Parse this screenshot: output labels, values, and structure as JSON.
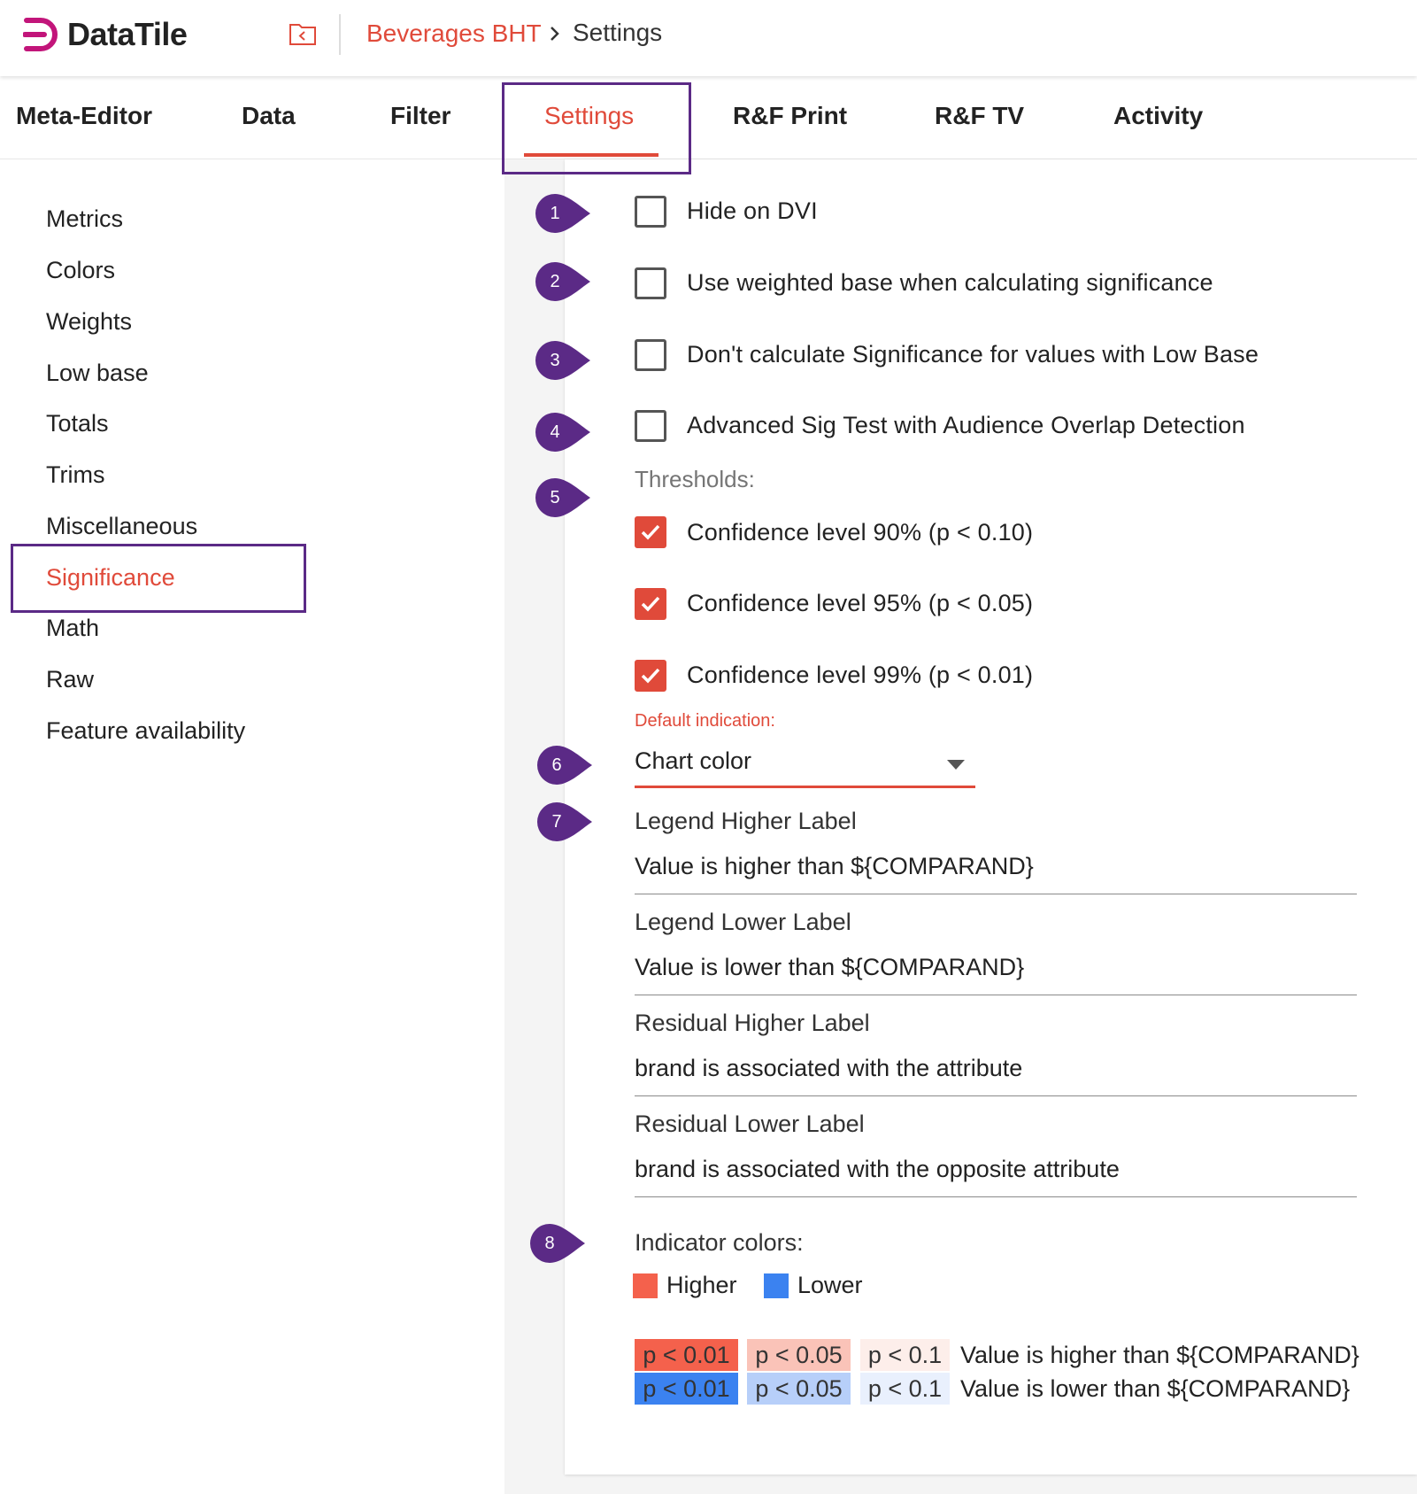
{
  "app": {
    "name": "DataTile",
    "brand_color": "#c2157a"
  },
  "breadcrumb": {
    "project": "Beverages BHT",
    "current": "Settings"
  },
  "tabs": [
    {
      "label": "Meta-Editor"
    },
    {
      "label": "Data"
    },
    {
      "label": "Filter"
    },
    {
      "label": "Settings",
      "active": true
    },
    {
      "label": "R&F Print"
    },
    {
      "label": "R&F TV"
    },
    {
      "label": "Activity"
    }
  ],
  "sidebar": {
    "items": [
      {
        "label": "Metrics"
      },
      {
        "label": "Colors"
      },
      {
        "label": "Weights"
      },
      {
        "label": "Low base"
      },
      {
        "label": "Totals"
      },
      {
        "label": "Trims"
      },
      {
        "label": "Miscellaneous"
      },
      {
        "label": "Significance",
        "active": true
      },
      {
        "label": "Math"
      },
      {
        "label": "Raw"
      },
      {
        "label": "Feature availability"
      }
    ]
  },
  "markers": [
    "1",
    "2",
    "3",
    "4",
    "5",
    "6",
    "7",
    "8"
  ],
  "options": [
    {
      "label": "Hide on DVI",
      "checked": false
    },
    {
      "label": "Use weighted base when calculating significance",
      "checked": false
    },
    {
      "label": "Don't calculate Significance for values with Low Base",
      "checked": false
    },
    {
      "label": "Advanced Sig Test with Audience Overlap Detection",
      "checked": false
    }
  ],
  "thresholds": {
    "label": "Thresholds:",
    "items": [
      {
        "label": "Confidence level 90% (p < 0.10)",
        "checked": true
      },
      {
        "label": "Confidence level 95% (p < 0.05)",
        "checked": true
      },
      {
        "label": "Confidence level 99% (p < 0.01)",
        "checked": true
      }
    ]
  },
  "default_indication": {
    "label": "Default indication:",
    "value": "Chart color"
  },
  "fields": [
    {
      "label": "Legend Higher Label",
      "value": "Value is higher than ${COMPARAND}"
    },
    {
      "label": "Legend Lower Label",
      "value": "Value is lower than ${COMPARAND}"
    },
    {
      "label": "Residual Higher Label",
      "value": "brand is associated with the attribute"
    },
    {
      "label": "Residual Lower Label",
      "value": "brand is associated with the opposite attribute"
    }
  ],
  "indicator_colors": {
    "label": "Indicator colors:",
    "higher": {
      "label": "Higher",
      "color": "#f4614c"
    },
    "lower": {
      "label": "Lower",
      "color": "#3b82f0"
    }
  },
  "significance_preview": {
    "higher": {
      "cells": [
        {
          "text": "p < 0.01",
          "color": "#f4614c"
        },
        {
          "text": "p < 0.05",
          "color": "#fac3b8"
        },
        {
          "text": "p < 0.1",
          "color": "#fdeeea"
        }
      ],
      "text": "Value is higher than ${COMPARAND}"
    },
    "lower": {
      "cells": [
        {
          "text": "p < 0.01",
          "color": "#3b82f0"
        },
        {
          "text": "p < 0.05",
          "color": "#b7cff9"
        },
        {
          "text": "p < 0.1",
          "color": "#e9f0fd"
        }
      ],
      "text": "Value is lower than ${COMPARAND}"
    }
  },
  "accent_color": "#e04a3a",
  "annotation_color": "#5b2a86"
}
